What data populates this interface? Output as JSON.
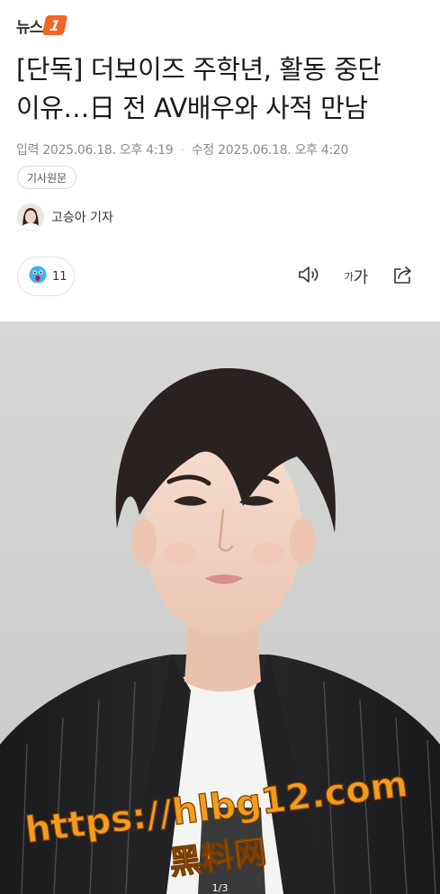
{
  "brand": {
    "logo_text": "뉴스",
    "logo_mark": "1",
    "accent_color": "#f26522"
  },
  "article": {
    "headline_line1": "[단독] 더보이즈 주학년, 활동 중단",
    "headline_line2": "이유…日 전 AV배우와 사적 만남",
    "published_label": "입력",
    "published": "2025.06.18. 오후 4:19",
    "modified_label": "수정",
    "modified": "2025.06.18. 오후 4:20",
    "original_button": "기사원문",
    "reporter": "고승아 기자"
  },
  "reactions": {
    "icon": "surprised-face-icon",
    "count": "11"
  },
  "toolbar": {
    "tts_icon": "speaker-icon",
    "font_small": "가",
    "font_large": "가",
    "share_icon": "share-icon"
  },
  "photo": {
    "counter": "1/3",
    "watermark_url": "https://hlbg12.com",
    "watermark_name": "黑料网"
  }
}
